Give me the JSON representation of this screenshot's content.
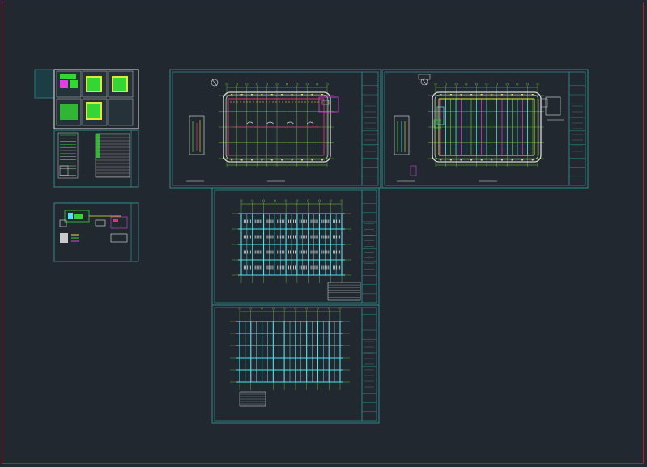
{
  "viewport": {
    "background": "#212830",
    "frame_color": "#b81e1e"
  },
  "colors": {
    "sheet_border": "#2e8a8a",
    "grid_green": "#33d633",
    "axis_green": "#7bd13b",
    "wall_white": "#d8d8d8",
    "pipe_red": "#e0307a",
    "pipe_magenta": "#e040e0",
    "duct_yellow": "#e6e63a",
    "beam_cyan": "#4fe3f0",
    "text_white": "#e6e6e6"
  },
  "sheets": [
    {
      "id": "cover-index"
    },
    {
      "id": "equipment-schedule"
    },
    {
      "id": "system-diagram"
    },
    {
      "id": "floor-plan-a"
    },
    {
      "id": "floor-plan-b"
    },
    {
      "id": "roof-framing-plan"
    },
    {
      "id": "foundation-plan"
    }
  ]
}
